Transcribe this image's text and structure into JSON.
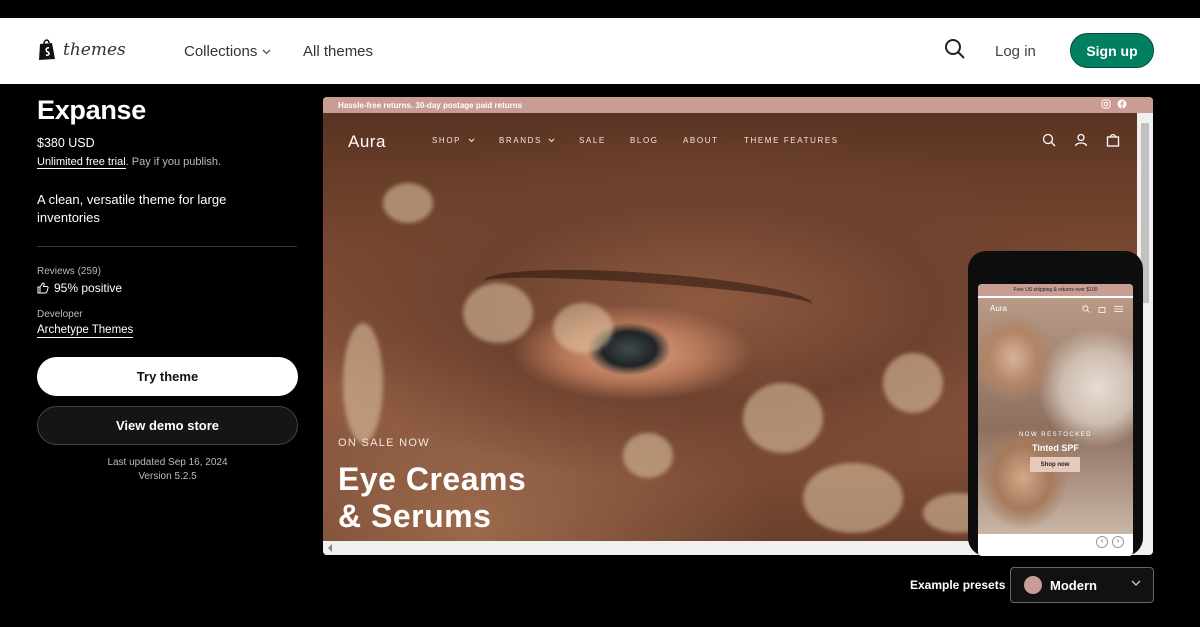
{
  "header": {
    "logo_text": "themes",
    "nav": {
      "collections": "Collections",
      "all_themes": "All themes"
    },
    "login": "Log in",
    "signup": "Sign up"
  },
  "theme": {
    "name": "Expanse",
    "price": "$380 USD",
    "trial_link": "Unlimited free trial",
    "trial_suffix": ". Pay if you publish.",
    "description": "A clean, versatile theme for large inventories",
    "reviews_label": "Reviews (259)",
    "reviews_value": "95% positive",
    "developer_label": "Developer",
    "developer_name": "Archetype Themes",
    "try_button": "Try theme",
    "demo_button": "View demo store",
    "last_updated": "Last updated Sep 16, 2024",
    "version": "Version 5.2.5"
  },
  "preview": {
    "announcement": "Hassle-free returns. 30-day postage paid returns",
    "store_logo": "Aura",
    "nav": [
      "SHOP",
      "BRANDS",
      "SALE",
      "BLOG",
      "ABOUT",
      "THEME FEATURES"
    ],
    "sale_tag": "ON SALE NOW",
    "headline_line1": "Eye Creams",
    "headline_line2": "& Serums",
    "accent_color": "#c99c94"
  },
  "phone": {
    "announcement": "Free US shipping & returns over $100",
    "logo": "Aura",
    "subtitle": "NOW RESTOCKED",
    "title": "Tinted SPF",
    "button": "Shop now"
  },
  "presets": {
    "label": "Example presets",
    "selected": "Modern",
    "swatch_color": "#c99c94"
  }
}
